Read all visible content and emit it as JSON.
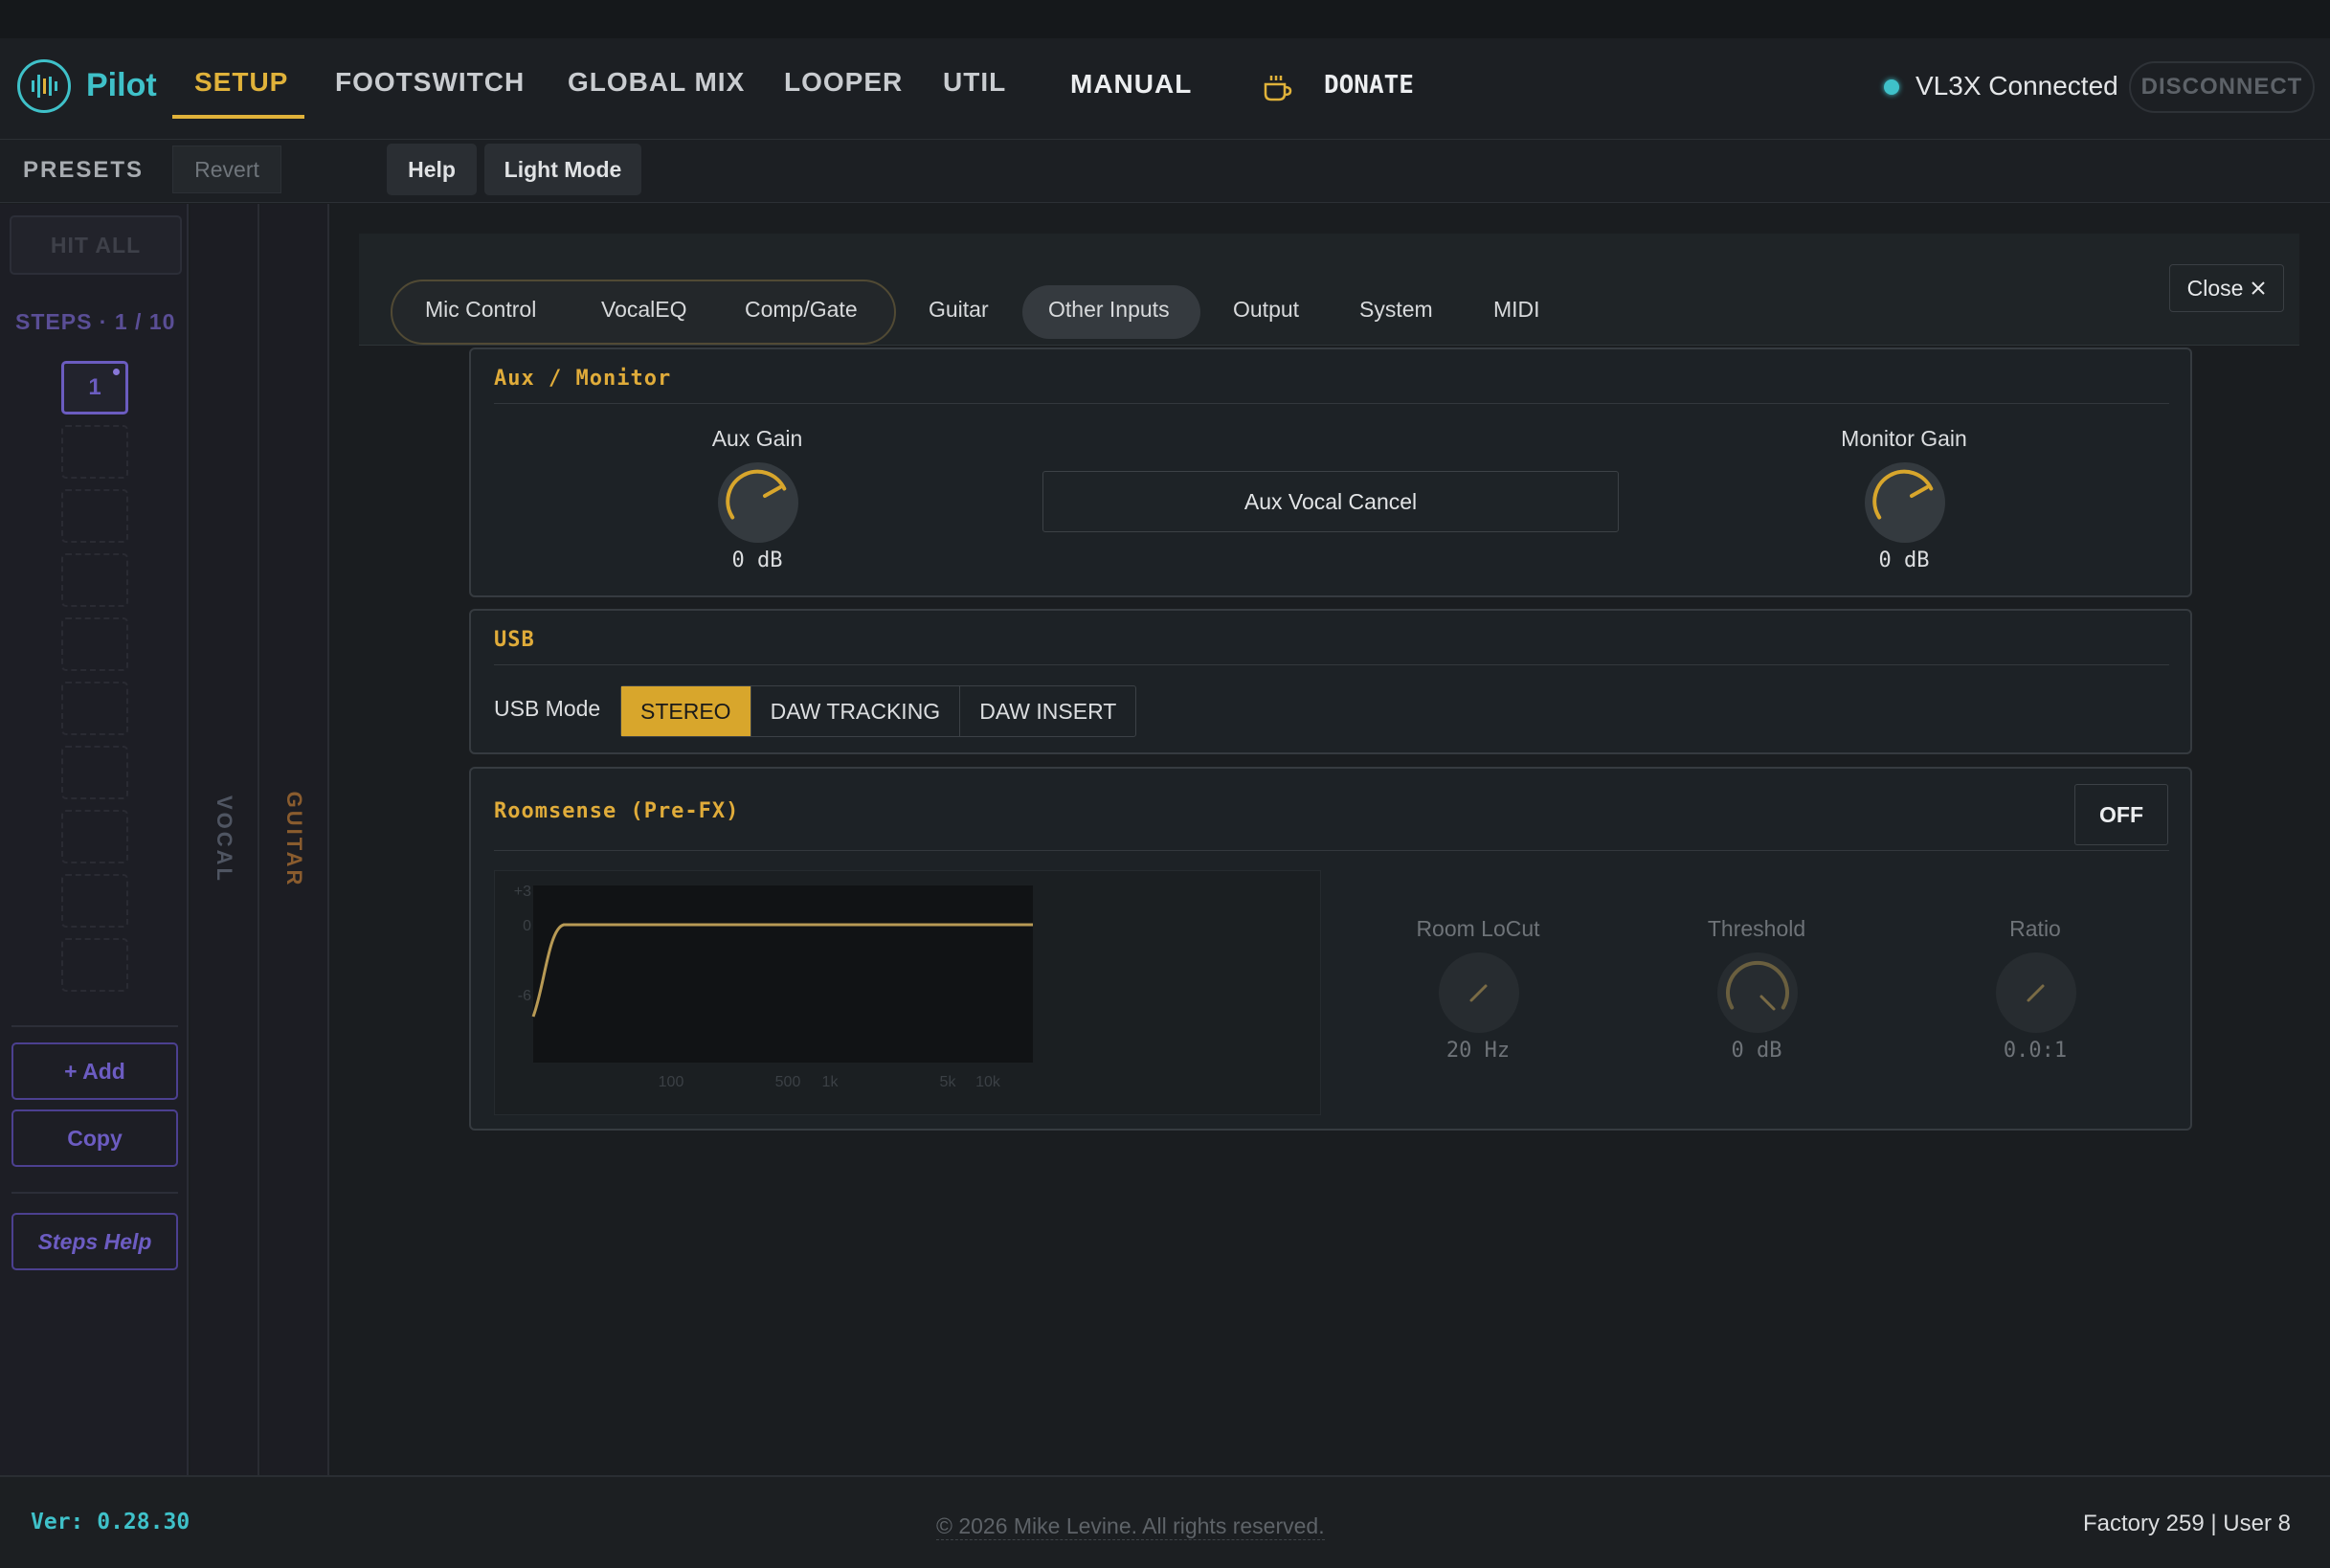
{
  "app": {
    "name": "Pilot"
  },
  "nav": {
    "tabs": [
      "SETUP",
      "FOOTSWITCH",
      "GLOBAL MIX",
      "LOOPER",
      "UTIL"
    ],
    "manual": "MANUAL",
    "donate": "DONATE",
    "active": "SETUP"
  },
  "connection": {
    "status": "VL3X Connected",
    "disconnect": "DISCONNECT",
    "color": "#3fc1c9"
  },
  "toolbar": {
    "presets": "PRESETS",
    "revert": "Revert",
    "help": "Help",
    "light_mode": "Light Mode"
  },
  "sidebar": {
    "hit_all": "HIT ALL",
    "steps": "STEPS · 1 / 10",
    "current_step": "1",
    "add": "+ Add",
    "copy": "Copy",
    "steps_help": "Steps Help"
  },
  "strips": {
    "vocal": "VOCAL",
    "guitar": "GUITAR"
  },
  "settings": {
    "tabs": [
      "Mic Control",
      "VocalEQ",
      "Comp/Gate",
      "Guitar",
      "Other Inputs",
      "Output",
      "System",
      "MIDI"
    ],
    "active_tab": "Other Inputs",
    "close": "Close"
  },
  "aux": {
    "title": "Aux / Monitor",
    "aux_gain": {
      "label": "Aux Gain",
      "value": "0 dB"
    },
    "vocal_cancel": "Aux Vocal Cancel",
    "monitor_gain": {
      "label": "Monitor Gain",
      "value": "0 dB"
    }
  },
  "usb": {
    "title": "USB",
    "mode_label": "USB Mode",
    "modes": [
      "STEREO",
      "DAW TRACKING",
      "DAW INSERT"
    ],
    "selected": "STEREO"
  },
  "roomsense": {
    "title": "Roomsense (Pre-FX)",
    "toggle": "OFF",
    "graph": {
      "y_ticks": [
        "+3",
        "0",
        "-6"
      ],
      "x_ticks": [
        "100",
        "500",
        "1k",
        "5k",
        "10k"
      ]
    },
    "locut": {
      "label": "Room LoCut",
      "value": "20 Hz"
    },
    "threshold": {
      "label": "Threshold",
      "value": "0 dB"
    },
    "ratio": {
      "label": "Ratio",
      "value": "0.0:1"
    }
  },
  "footer": {
    "version": "Ver: 0.28.30",
    "copyright": "© 2026 Mike Levine. All rights reserved.",
    "counts": "Factory 259 | User 8"
  },
  "colors": {
    "accent": "#e0b23a",
    "teal": "#3fc1c9",
    "purple": "#6b5cc0"
  }
}
